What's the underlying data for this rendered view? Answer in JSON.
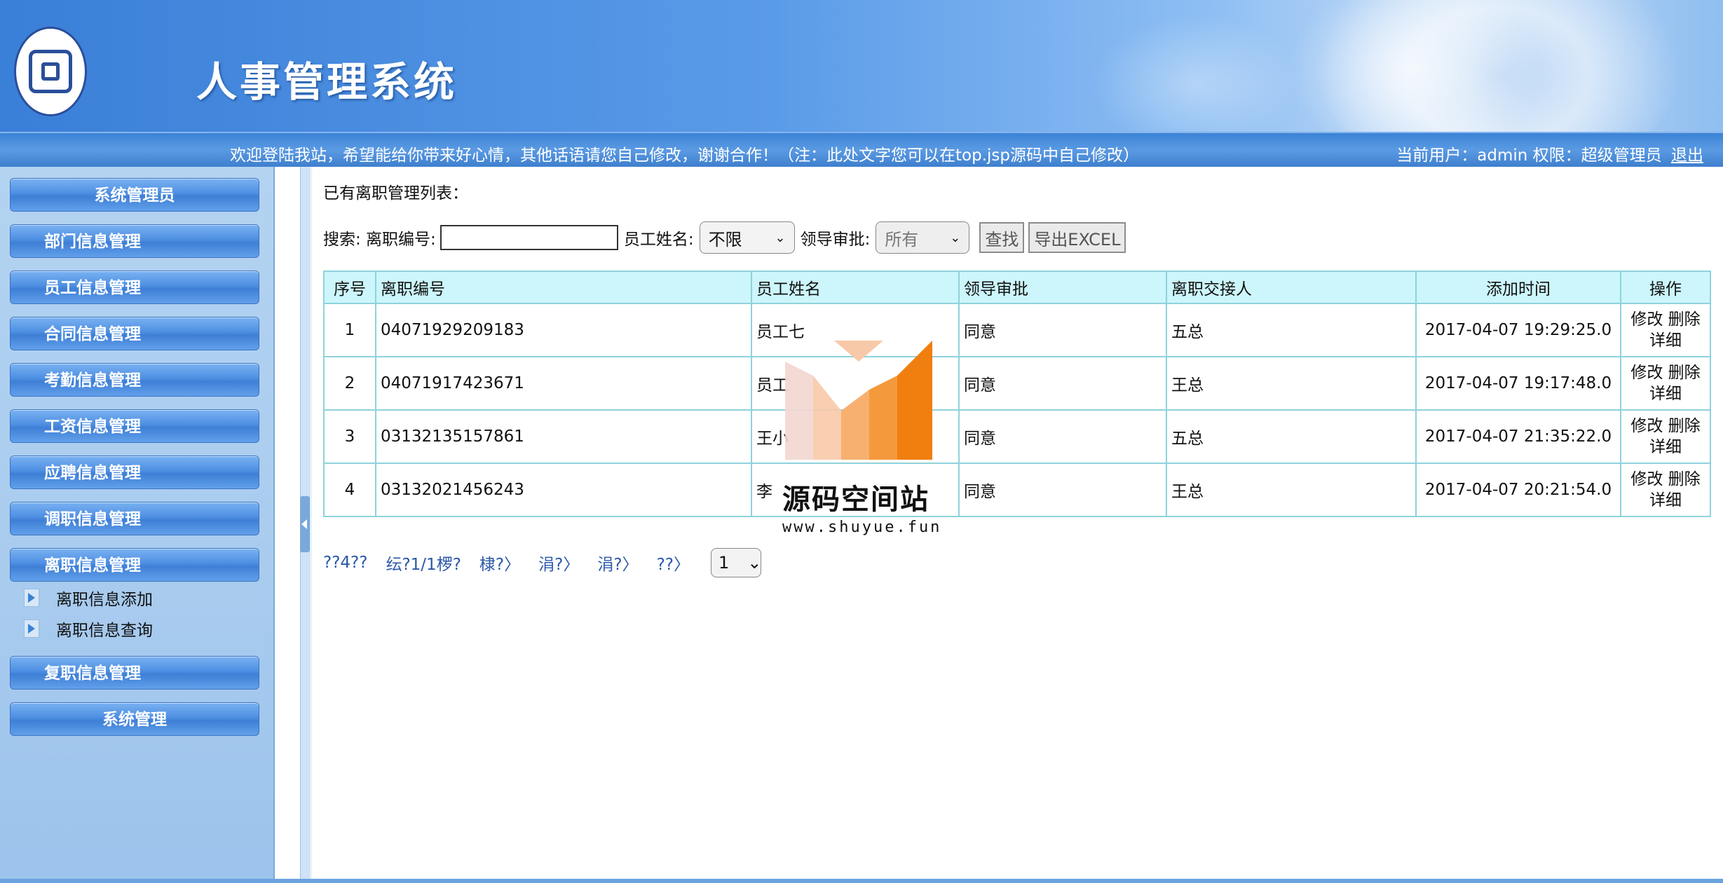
{
  "app": {
    "title": "人事管理系统",
    "welcome": "欢迎登陆我站，希望能给你带来好心情，其他话语请您自己修改，谢谢合作！（注：此处文字您可以在top.jsp源码中自己修改）",
    "user_info": "当前用户：admin 权限：超级管理员",
    "logout": "退出"
  },
  "sidebar": {
    "items": [
      {
        "label": "系统管理员"
      },
      {
        "label": "部门信息管理"
      },
      {
        "label": "员工信息管理"
      },
      {
        "label": "合同信息管理"
      },
      {
        "label": "考勤信息管理"
      },
      {
        "label": "工资信息管理"
      },
      {
        "label": "应聘信息管理"
      },
      {
        "label": "调职信息管理"
      },
      {
        "label": "离职信息管理"
      },
      {
        "label": "复职信息管理"
      },
      {
        "label": "系统管理"
      }
    ],
    "subitems": [
      {
        "label": "离职信息添加"
      },
      {
        "label": "离职信息查询"
      }
    ]
  },
  "main": {
    "list_title": "已有离职管理列表：",
    "search": {
      "label_prefix": "搜索: 离职编号:",
      "name_label": "员工姓名:",
      "name_select": "不限",
      "approval_label": "领导审批:",
      "approval_select": "所有",
      "find_button": "查找",
      "export_button": "导出EXCEL"
    },
    "table": {
      "headers": [
        "序号",
        "离职编号",
        "员工姓名",
        "领导审批",
        "离职交接人",
        "添加时间",
        "操作"
      ],
      "rows": [
        {
          "no": "1",
          "code": "04071929209183",
          "name": "员工七",
          "approval": "同意",
          "handover": "五总",
          "time": "2017-04-07 19:29:25.0"
        },
        {
          "no": "2",
          "code": "04071917423671",
          "name": "员工",
          "approval": "同意",
          "handover": "王总",
          "time": "2017-04-07 19:17:48.0"
        },
        {
          "no": "3",
          "code": "03132135157861",
          "name": "王小",
          "approval": "同意",
          "handover": "五总",
          "time": "2017-04-07 21:35:22.0"
        },
        {
          "no": "4",
          "code": "03132021456243",
          "name": "李",
          "approval": "同意",
          "handover": "王总",
          "time": "2017-04-07 20:21:54.0"
        }
      ],
      "op_edit": "修改",
      "op_delete": "删除",
      "op_detail": "详细"
    },
    "pager": {
      "items": [
        "??4??",
        "纭?1/1椤?",
        "棣?〉",
        "涓?〉",
        "涓?〉",
        "??〉"
      ],
      "page_select": "1"
    }
  },
  "watermark": {
    "text": "源码空间站",
    "url": "www.shuyue.fun"
  },
  "colors": {
    "header_blue": "#3a7fd8",
    "menu_blue": "#4e8fe2",
    "table_header": "#ccf6fb",
    "table_border": "#8fd2dc"
  }
}
